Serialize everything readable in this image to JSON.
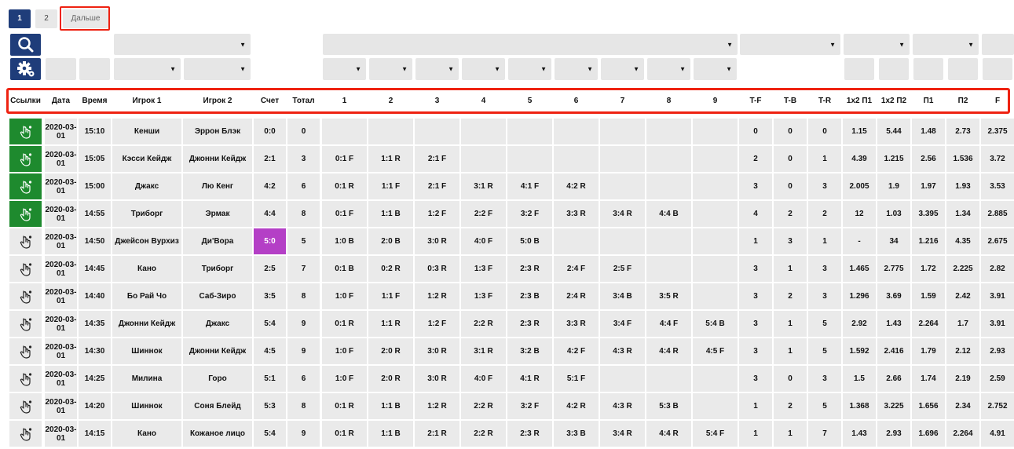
{
  "pagination": {
    "page1": "1",
    "page2": "2",
    "next": "Дальше"
  },
  "columns": [
    "Ссылки",
    "Дата",
    "Время",
    "Игрок 1",
    "Игрок 2",
    "Счет",
    "Тотал",
    "1",
    "2",
    "3",
    "4",
    "5",
    "6",
    "7",
    "8",
    "9",
    "T-F",
    "T-B",
    "T-R",
    "1x2 П1",
    "1x2 П2",
    "П1",
    "П2",
    "F"
  ],
  "icons": {
    "search": "search-icon",
    "settings": "gear-icon",
    "link": "hand-pointer-icon"
  },
  "colors": {
    "accent": "#1f3d7a",
    "link_active": "#1e8a2e",
    "score_highlight": "#b43fc6",
    "highlight_border": "#e21"
  },
  "rows": [
    {
      "link_active": true,
      "date": "2020-03-01",
      "time": "15:10",
      "p1": "Кенши",
      "p2": "Эррон Блэк",
      "score": "0:0",
      "total": "0",
      "r": [
        "",
        "",
        "",
        "",
        "",
        "",
        "",
        "",
        ""
      ],
      "tf": "0",
      "tb": "0",
      "tr": "0",
      "x1": "1.15",
      "x2": "5.44",
      "pp1": "1.48",
      "pp2": "2.73",
      "f": "2.375"
    },
    {
      "link_active": true,
      "date": "2020-03-01",
      "time": "15:05",
      "p1": "Кэсси Кейдж",
      "p2": "Джонни Кейдж",
      "score": "2:1",
      "total": "3",
      "r": [
        "0:1 F",
        "1:1 R",
        "2:1 F",
        "",
        "",
        "",
        "",
        "",
        ""
      ],
      "tf": "2",
      "tb": "0",
      "tr": "1",
      "x1": "4.39",
      "x2": "1.215",
      "pp1": "2.56",
      "pp2": "1.536",
      "f": "3.72"
    },
    {
      "link_active": true,
      "date": "2020-03-01",
      "time": "15:00",
      "p1": "Джакс",
      "p2": "Лю Кенг",
      "score": "4:2",
      "total": "6",
      "r": [
        "0:1 R",
        "1:1 F",
        "2:1 F",
        "3:1 R",
        "4:1 F",
        "4:2 R",
        "",
        "",
        ""
      ],
      "tf": "3",
      "tb": "0",
      "tr": "3",
      "x1": "2.005",
      "x2": "1.9",
      "pp1": "1.97",
      "pp2": "1.93",
      "f": "3.53"
    },
    {
      "link_active": true,
      "date": "2020-03-01",
      "time": "14:55",
      "p1": "Триборг",
      "p2": "Эрмак",
      "score": "4:4",
      "total": "8",
      "r": [
        "0:1 F",
        "1:1 B",
        "1:2 F",
        "2:2 F",
        "3:2 F",
        "3:3 R",
        "3:4 R",
        "4:4 B",
        ""
      ],
      "tf": "4",
      "tb": "2",
      "tr": "2",
      "x1": "12",
      "x2": "1.03",
      "pp1": "3.395",
      "pp2": "1.34",
      "f": "2.885"
    },
    {
      "link_active": false,
      "date": "2020-03-01",
      "time": "14:50",
      "p1": "Джейсон Вурхиз",
      "p2": "Ди'Вора",
      "score": "5:0",
      "score_hl": true,
      "total": "5",
      "r": [
        "1:0 B",
        "2:0 B",
        "3:0 R",
        "4:0 F",
        "5:0 B",
        "",
        "",
        "",
        ""
      ],
      "tf": "1",
      "tb": "3",
      "tr": "1",
      "x1": "-",
      "x2": "34",
      "pp1": "1.216",
      "pp2": "4.35",
      "f": "2.675"
    },
    {
      "link_active": false,
      "date": "2020-03-01",
      "time": "14:45",
      "p1": "Кано",
      "p2": "Триборг",
      "score": "2:5",
      "total": "7",
      "r": [
        "0:1 B",
        "0:2 R",
        "0:3 R",
        "1:3 F",
        "2:3 R",
        "2:4 F",
        "2:5 F",
        "",
        ""
      ],
      "tf": "3",
      "tb": "1",
      "tr": "3",
      "x1": "1.465",
      "x2": "2.775",
      "pp1": "1.72",
      "pp2": "2.225",
      "f": "2.82"
    },
    {
      "link_active": false,
      "date": "2020-03-01",
      "time": "14:40",
      "p1": "Бо Рай Чо",
      "p2": "Саб-Зиро",
      "score": "3:5",
      "total": "8",
      "r": [
        "1:0 F",
        "1:1 F",
        "1:2 R",
        "1:3 F",
        "2:3 B",
        "2:4 R",
        "3:4 B",
        "3:5 R",
        ""
      ],
      "tf": "3",
      "tb": "2",
      "tr": "3",
      "x1": "1.296",
      "x2": "3.69",
      "pp1": "1.59",
      "pp2": "2.42",
      "f": "3.91"
    },
    {
      "link_active": false,
      "date": "2020-03-01",
      "time": "14:35",
      "p1": "Джонни Кейдж",
      "p2": "Джакс",
      "score": "5:4",
      "total": "9",
      "r": [
        "0:1 R",
        "1:1 R",
        "1:2 F",
        "2:2 R",
        "2:3 R",
        "3:3 R",
        "3:4 F",
        "4:4 F",
        "5:4 B"
      ],
      "tf": "3",
      "tb": "1",
      "tr": "5",
      "x1": "2.92",
      "x2": "1.43",
      "pp1": "2.264",
      "pp2": "1.7",
      "f": "3.91"
    },
    {
      "link_active": false,
      "date": "2020-03-01",
      "time": "14:30",
      "p1": "Шиннок",
      "p2": "Джонни Кейдж",
      "score": "4:5",
      "total": "9",
      "r": [
        "1:0 F",
        "2:0 R",
        "3:0 R",
        "3:1 R",
        "3:2 B",
        "4:2 F",
        "4:3 R",
        "4:4 R",
        "4:5 F"
      ],
      "tf": "3",
      "tb": "1",
      "tr": "5",
      "x1": "1.592",
      "x2": "2.416",
      "pp1": "1.79",
      "pp2": "2.12",
      "f": "2.93"
    },
    {
      "link_active": false,
      "date": "2020-03-01",
      "time": "14:25",
      "p1": "Милина",
      "p2": "Горо",
      "score": "5:1",
      "total": "6",
      "r": [
        "1:0 F",
        "2:0 R",
        "3:0 R",
        "4:0 F",
        "4:1 R",
        "5:1 F",
        "",
        "",
        ""
      ],
      "tf": "3",
      "tb": "0",
      "tr": "3",
      "x1": "1.5",
      "x2": "2.66",
      "pp1": "1.74",
      "pp2": "2.19",
      "f": "2.59"
    },
    {
      "link_active": false,
      "date": "2020-03-01",
      "time": "14:20",
      "p1": "Шиннок",
      "p2": "Соня Блейд",
      "score": "5:3",
      "total": "8",
      "r": [
        "0:1 R",
        "1:1 B",
        "1:2 R",
        "2:2 R",
        "3:2 F",
        "4:2 R",
        "4:3 R",
        "5:3 B",
        ""
      ],
      "tf": "1",
      "tb": "2",
      "tr": "5",
      "x1": "1.368",
      "x2": "3.225",
      "pp1": "1.656",
      "pp2": "2.34",
      "f": "2.752"
    },
    {
      "link_active": false,
      "date": "2020-03-01",
      "time": "14:15",
      "p1": "Кано",
      "p2": "Кожаное лицо",
      "score": "5:4",
      "total": "9",
      "r": [
        "0:1 R",
        "1:1 B",
        "2:1 R",
        "2:2 R",
        "2:3 R",
        "3:3 B",
        "3:4 R",
        "4:4 R",
        "5:4 F"
      ],
      "tf": "1",
      "tb": "1",
      "tr": "7",
      "x1": "1.43",
      "x2": "2.93",
      "pp1": "1.696",
      "pp2": "2.264",
      "f": "4.91"
    }
  ]
}
